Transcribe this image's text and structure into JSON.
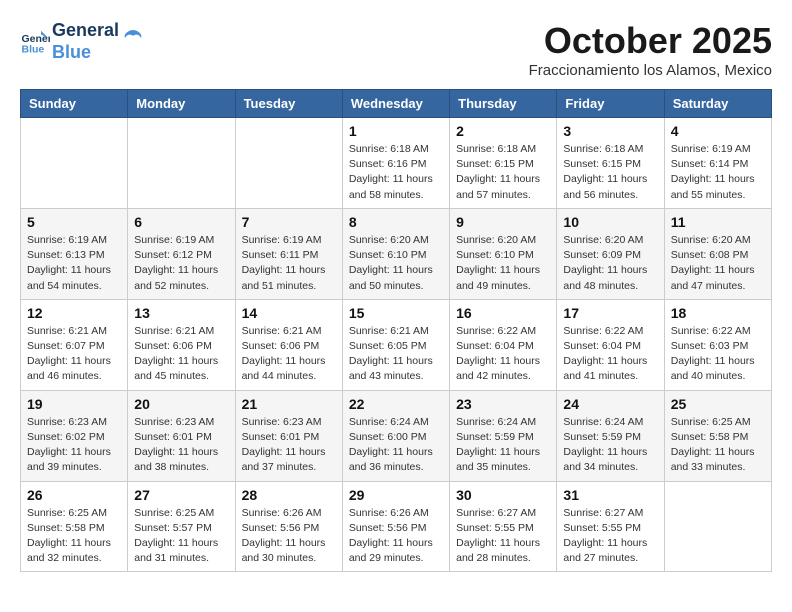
{
  "header": {
    "logo_line1": "General",
    "logo_line2": "Blue",
    "month": "October 2025",
    "location": "Fraccionamiento los Alamos, Mexico"
  },
  "weekdays": [
    "Sunday",
    "Monday",
    "Tuesday",
    "Wednesday",
    "Thursday",
    "Friday",
    "Saturday"
  ],
  "weeks": [
    [
      {
        "day": "",
        "info": ""
      },
      {
        "day": "",
        "info": ""
      },
      {
        "day": "",
        "info": ""
      },
      {
        "day": "1",
        "info": "Sunrise: 6:18 AM\nSunset: 6:16 PM\nDaylight: 11 hours\nand 58 minutes."
      },
      {
        "day": "2",
        "info": "Sunrise: 6:18 AM\nSunset: 6:15 PM\nDaylight: 11 hours\nand 57 minutes."
      },
      {
        "day": "3",
        "info": "Sunrise: 6:18 AM\nSunset: 6:15 PM\nDaylight: 11 hours\nand 56 minutes."
      },
      {
        "day": "4",
        "info": "Sunrise: 6:19 AM\nSunset: 6:14 PM\nDaylight: 11 hours\nand 55 minutes."
      }
    ],
    [
      {
        "day": "5",
        "info": "Sunrise: 6:19 AM\nSunset: 6:13 PM\nDaylight: 11 hours\nand 54 minutes."
      },
      {
        "day": "6",
        "info": "Sunrise: 6:19 AM\nSunset: 6:12 PM\nDaylight: 11 hours\nand 52 minutes."
      },
      {
        "day": "7",
        "info": "Sunrise: 6:19 AM\nSunset: 6:11 PM\nDaylight: 11 hours\nand 51 minutes."
      },
      {
        "day": "8",
        "info": "Sunrise: 6:20 AM\nSunset: 6:10 PM\nDaylight: 11 hours\nand 50 minutes."
      },
      {
        "day": "9",
        "info": "Sunrise: 6:20 AM\nSunset: 6:10 PM\nDaylight: 11 hours\nand 49 minutes."
      },
      {
        "day": "10",
        "info": "Sunrise: 6:20 AM\nSunset: 6:09 PM\nDaylight: 11 hours\nand 48 minutes."
      },
      {
        "day": "11",
        "info": "Sunrise: 6:20 AM\nSunset: 6:08 PM\nDaylight: 11 hours\nand 47 minutes."
      }
    ],
    [
      {
        "day": "12",
        "info": "Sunrise: 6:21 AM\nSunset: 6:07 PM\nDaylight: 11 hours\nand 46 minutes."
      },
      {
        "day": "13",
        "info": "Sunrise: 6:21 AM\nSunset: 6:06 PM\nDaylight: 11 hours\nand 45 minutes."
      },
      {
        "day": "14",
        "info": "Sunrise: 6:21 AM\nSunset: 6:06 PM\nDaylight: 11 hours\nand 44 minutes."
      },
      {
        "day": "15",
        "info": "Sunrise: 6:21 AM\nSunset: 6:05 PM\nDaylight: 11 hours\nand 43 minutes."
      },
      {
        "day": "16",
        "info": "Sunrise: 6:22 AM\nSunset: 6:04 PM\nDaylight: 11 hours\nand 42 minutes."
      },
      {
        "day": "17",
        "info": "Sunrise: 6:22 AM\nSunset: 6:04 PM\nDaylight: 11 hours\nand 41 minutes."
      },
      {
        "day": "18",
        "info": "Sunrise: 6:22 AM\nSunset: 6:03 PM\nDaylight: 11 hours\nand 40 minutes."
      }
    ],
    [
      {
        "day": "19",
        "info": "Sunrise: 6:23 AM\nSunset: 6:02 PM\nDaylight: 11 hours\nand 39 minutes."
      },
      {
        "day": "20",
        "info": "Sunrise: 6:23 AM\nSunset: 6:01 PM\nDaylight: 11 hours\nand 38 minutes."
      },
      {
        "day": "21",
        "info": "Sunrise: 6:23 AM\nSunset: 6:01 PM\nDaylight: 11 hours\nand 37 minutes."
      },
      {
        "day": "22",
        "info": "Sunrise: 6:24 AM\nSunset: 6:00 PM\nDaylight: 11 hours\nand 36 minutes."
      },
      {
        "day": "23",
        "info": "Sunrise: 6:24 AM\nSunset: 5:59 PM\nDaylight: 11 hours\nand 35 minutes."
      },
      {
        "day": "24",
        "info": "Sunrise: 6:24 AM\nSunset: 5:59 PM\nDaylight: 11 hours\nand 34 minutes."
      },
      {
        "day": "25",
        "info": "Sunrise: 6:25 AM\nSunset: 5:58 PM\nDaylight: 11 hours\nand 33 minutes."
      }
    ],
    [
      {
        "day": "26",
        "info": "Sunrise: 6:25 AM\nSunset: 5:58 PM\nDaylight: 11 hours\nand 32 minutes."
      },
      {
        "day": "27",
        "info": "Sunrise: 6:25 AM\nSunset: 5:57 PM\nDaylight: 11 hours\nand 31 minutes."
      },
      {
        "day": "28",
        "info": "Sunrise: 6:26 AM\nSunset: 5:56 PM\nDaylight: 11 hours\nand 30 minutes."
      },
      {
        "day": "29",
        "info": "Sunrise: 6:26 AM\nSunset: 5:56 PM\nDaylight: 11 hours\nand 29 minutes."
      },
      {
        "day": "30",
        "info": "Sunrise: 6:27 AM\nSunset: 5:55 PM\nDaylight: 11 hours\nand 28 minutes."
      },
      {
        "day": "31",
        "info": "Sunrise: 6:27 AM\nSunset: 5:55 PM\nDaylight: 11 hours\nand 27 minutes."
      },
      {
        "day": "",
        "info": ""
      }
    ]
  ]
}
